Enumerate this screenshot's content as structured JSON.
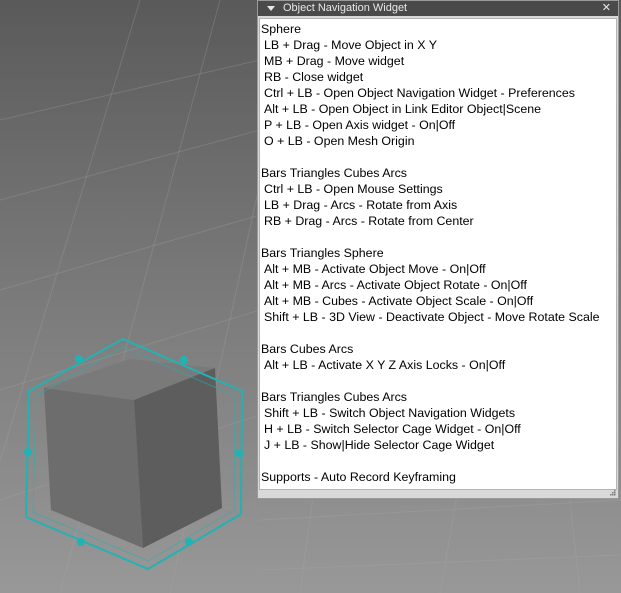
{
  "panel": {
    "title": "Object Navigation Widget",
    "close_glyph": "✕",
    "collapse_icon": "triangle-down-icon"
  },
  "lines": [
    {
      "type": "header",
      "text": "Sphere"
    },
    {
      "type": "item",
      "text": "LB + Drag - Move Object in X Y"
    },
    {
      "type": "item",
      "text": "MB + Drag - Move widget"
    },
    {
      "type": "item",
      "text": "RB - Close widget"
    },
    {
      "type": "item",
      "text": "Ctrl + LB - Open Object Navigation Widget - Preferences"
    },
    {
      "type": "item",
      "text": "Alt + LB - Open Object in Link Editor Object|Scene"
    },
    {
      "type": "item",
      "text": "P + LB - Open Axis widget - On|Off"
    },
    {
      "type": "item",
      "text": "O + LB - Open Mesh Origin"
    },
    {
      "type": "blank",
      "text": ""
    },
    {
      "type": "header",
      "text": "Bars Triangles Cubes Arcs"
    },
    {
      "type": "item",
      "text": "Ctrl + LB - Open Mouse Settings"
    },
    {
      "type": "item",
      "text": "LB + Drag - Arcs - Rotate from Axis"
    },
    {
      "type": "item",
      "text": "RB + Drag - Arcs - Rotate from Center"
    },
    {
      "type": "blank",
      "text": ""
    },
    {
      "type": "header",
      "text": "Bars Triangles Sphere"
    },
    {
      "type": "item",
      "text": "Alt + MB - Activate Object Move - On|Off"
    },
    {
      "type": "item",
      "text": "Alt + MB - Arcs - Activate Object Rotate - On|Off"
    },
    {
      "type": "item",
      "text": "Alt + MB - Cubes - Activate Object Scale - On|Off"
    },
    {
      "type": "item",
      "text": "Shift + LB - 3D View - Deactivate Object - Move Rotate Scale"
    },
    {
      "type": "blank",
      "text": ""
    },
    {
      "type": "header",
      "text": "Bars Cubes Arcs"
    },
    {
      "type": "item",
      "text": "Alt + LB - Activate X Y Z Axis Locks - On|Off"
    },
    {
      "type": "blank",
      "text": ""
    },
    {
      "type": "header",
      "text": "Bars Triangles Cubes Arcs"
    },
    {
      "type": "item",
      "text": "Shift + LB - Switch Object Navigation Widgets"
    },
    {
      "type": "item",
      "text": "H + LB - Switch Selector Cage Widget - On|Off"
    },
    {
      "type": "item",
      "text": "J + LB - Show|Hide Selector Cage Widget"
    },
    {
      "type": "blank",
      "text": ""
    },
    {
      "type": "header",
      "text": "Supports - Auto Record Keyframing"
    }
  ],
  "colors": {
    "widget_accent": "#21b3b3",
    "cube_face_front": "#6e6e6e",
    "cube_face_top": "#7c7c7c",
    "cube_face_side": "#5c5c5c",
    "titlebar_bg": "#4a4a4a",
    "panel_bg": "#d9d9d9"
  }
}
